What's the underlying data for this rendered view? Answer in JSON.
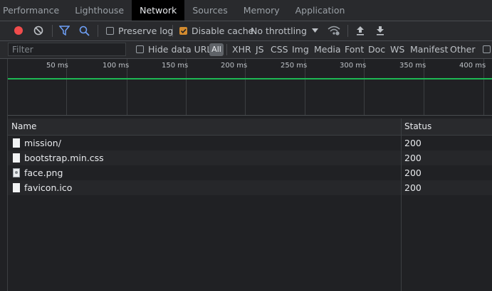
{
  "tabs": [
    {
      "label": "Performance",
      "active": false
    },
    {
      "label": "Lighthouse",
      "active": false
    },
    {
      "label": "Network",
      "active": true
    },
    {
      "label": "Sources",
      "active": false
    },
    {
      "label": "Memory",
      "active": false
    },
    {
      "label": "Application",
      "active": false
    }
  ],
  "toolbar": {
    "record_icon": "record-icon",
    "clear_icon": "clear-icon",
    "filter_icon": "filter-icon",
    "search_icon": "search-icon",
    "preserve_log": {
      "label": "Preserve log",
      "checked": false
    },
    "disable_cache": {
      "label": "Disable cache",
      "checked": true
    },
    "throttling": "No throttling",
    "record_color": "#f14c4c",
    "accent_color": "#d38b2f"
  },
  "filterbar": {
    "placeholder": "Filter",
    "hide_data_urls": "Hide data URLs",
    "types": [
      "All",
      "XHR",
      "JS",
      "CSS",
      "Img",
      "Media",
      "Font",
      "Doc",
      "WS",
      "Manifest",
      "Other"
    ]
  },
  "timeline": {
    "ticks": [
      "50 ms",
      "100 ms",
      "150 ms",
      "200 ms",
      "250 ms",
      "300 ms",
      "350 ms",
      "400 ms"
    ]
  },
  "table": {
    "columns": [
      "Name",
      "Status"
    ],
    "rows": [
      {
        "name": "mission/",
        "status": "200",
        "icon": "document-icon"
      },
      {
        "name": "bootstrap.min.css",
        "status": "200",
        "icon": "document-icon"
      },
      {
        "name": "face.png",
        "status": "200",
        "icon": "image-icon"
      },
      {
        "name": "favicon.ico",
        "status": "200",
        "icon": "document-icon"
      }
    ]
  }
}
